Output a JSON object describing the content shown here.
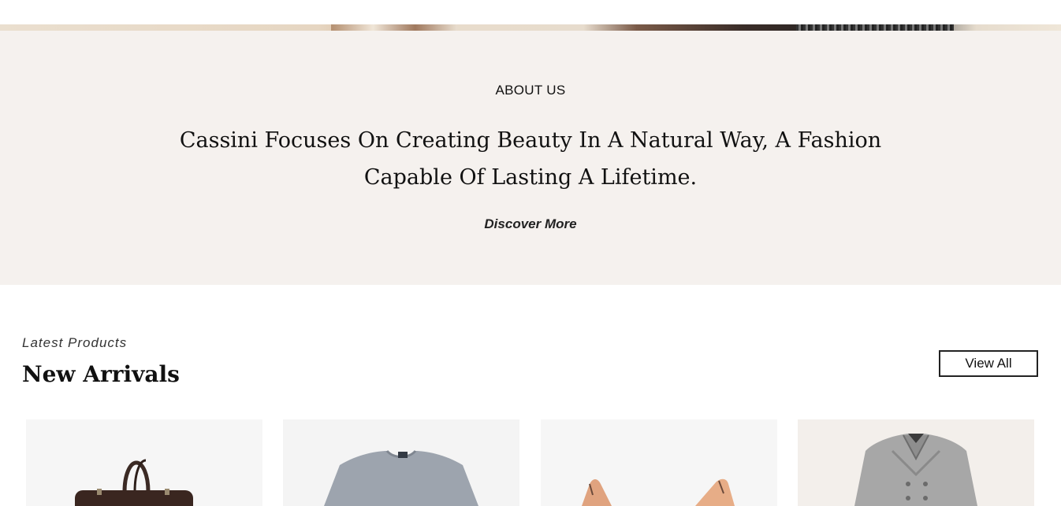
{
  "about": {
    "eyebrow": "ABOUT US",
    "heading_line1": "Cassini Focuses On Creating Beauty In A Natural Way, A Fashion",
    "heading_line2": "Capable Of Lasting A Lifetime.",
    "cta": "Discover More"
  },
  "products": {
    "eyebrow": "Latest Products",
    "title": "New Arrivals",
    "view_all": "View All",
    "items": [
      {
        "icon": "leather-bag-image"
      },
      {
        "icon": "grey-tshirt-image"
      },
      {
        "icon": "nude-heels-image"
      },
      {
        "icon": "grey-coat-image"
      }
    ]
  },
  "colors": {
    "about_bg": "#f5f1ee",
    "text": "#111111",
    "button_border": "#222222"
  }
}
